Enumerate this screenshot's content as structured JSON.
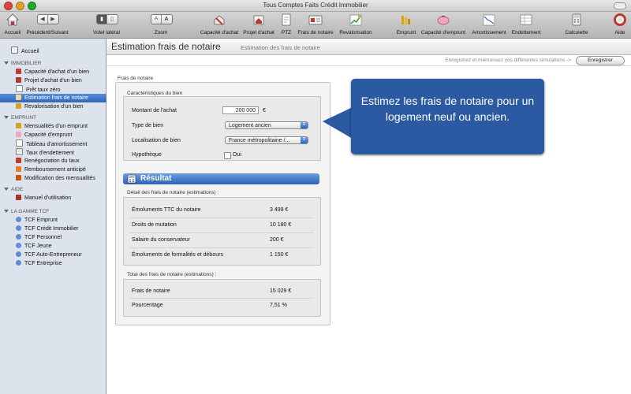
{
  "window": {
    "title": "Tous Comptes Faits Crédit Immobilier"
  },
  "toolbar": {
    "accueil": "Accueil",
    "precedent_suivant": "Précédent/Suivant",
    "volet_lateral": "Volet latéral",
    "zoom": "Zoom",
    "zoom_small": "A",
    "zoom_large": "A",
    "capacite_achat": "Capacité d'achat",
    "projet_achat": "Projet d'achat",
    "ptz": "PTZ",
    "frais_notaire": "Frais de notaire",
    "revalorisation": "Revalorisation",
    "emprunt": "Emprunt",
    "capacite_emprunt": "Capacité d'emprunt",
    "amortissement": "Amortissement",
    "endettement": "Endettement",
    "calculette": "Calculette",
    "aide": "Aide"
  },
  "sidebar": {
    "accueil": "Accueil",
    "immobilier": {
      "header": "IMMOBILIER",
      "items": [
        "Capacité d'achat d'un bien",
        "Projet d'achat d'un bien",
        "Prêt taux zéro",
        "Estimation frais de notaire",
        "Revalorisation d'un bien"
      ]
    },
    "emprunt": {
      "header": "EMPRUNT",
      "items": [
        "Mensualités d'un emprunt",
        "Capacité d'emprunt",
        "Tableau d'amortissement",
        "Taux d'endettement",
        "Renégociation du taux",
        "Remboursement anticipé",
        "Modification des mensualités"
      ]
    },
    "aide": {
      "header": "AIDE",
      "items": [
        "Manuel d'utilisation"
      ]
    },
    "gamme": {
      "header": "LA GAMME TCF",
      "items": [
        "TCF Emprunt",
        "TCF Crédit Immobilier",
        "TCF Personnel",
        "TCF Jeune",
        "TCF Auto-Entrepreneur",
        "TCF Entreprise"
      ]
    }
  },
  "header": {
    "title": "Estimation frais de notaire",
    "subtitle": "Estimation des frais de notaire"
  },
  "savebar": {
    "hint": "Enregistrez et mémorisez vos différentes simulations ->",
    "button": "Enregistrer"
  },
  "form": {
    "group_label": "Frais de notaire",
    "section_label": "Caractéristiques du bien",
    "montant_label": "Montant de l'achat",
    "montant_value": "200 000",
    "currency": "€",
    "type_label": "Type de bien",
    "type_value": "Logement ancien",
    "localisation_label": "Localisation de bien",
    "localisation_value": "France métropolitaine /...",
    "hypotheque_label": "Hypothèque",
    "hypotheque_option": "Oui"
  },
  "result": {
    "title": "Résultat",
    "detail_label": "Détail des frais de notaire (estimations) :",
    "rows": [
      {
        "label": "Émoluments TTC du notaire",
        "value": "3 499 €"
      },
      {
        "label": "Droits de mutation",
        "value": "10 180 €"
      },
      {
        "label": "Salaire du conservateur",
        "value": "200 €"
      },
      {
        "label": "Émoluments de formalités et débours",
        "value": "1 150 €"
      }
    ],
    "total_label": "Total des frais de notaire (estimations) :",
    "total_rows": [
      {
        "label": "Frais de notaire",
        "value": "15 029 €"
      },
      {
        "label": "Pourcentage",
        "value": "7,51 %"
      }
    ]
  },
  "callout": {
    "text": "Estimez les frais de notaire pour un logement neuf ou ancien."
  },
  "colors": {
    "accent": "#2f64b9",
    "callout": "#2b5aa3",
    "sidebar": "#dde3ec"
  }
}
